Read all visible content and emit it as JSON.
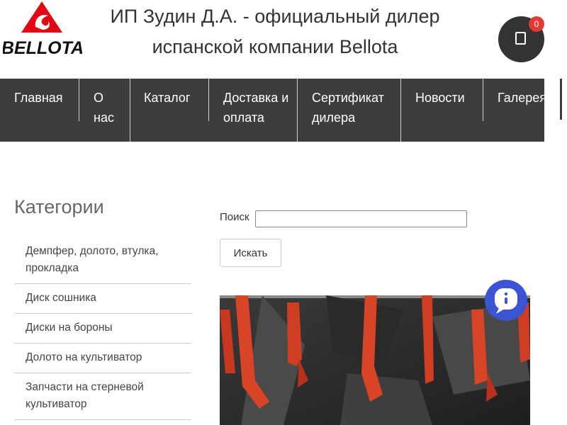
{
  "header": {
    "logo_text": "BELLOTA",
    "title": "ИП Зудин Д.А. - официальный дилер испанской компании Bellota",
    "cart_count": "0"
  },
  "nav": {
    "items": [
      {
        "label": "Главная"
      },
      {
        "label": "О нас"
      },
      {
        "label": "Каталог"
      },
      {
        "label": "Доставка и оплата"
      },
      {
        "label": "Сертификат дилера"
      },
      {
        "label": "Новости"
      },
      {
        "label": "Галерея"
      }
    ]
  },
  "sidebar": {
    "title": "Категории",
    "categories": [
      "Демпфер, долото, втулка, прокладка",
      "Диск сошника",
      "Диски на бороны",
      "Долото на культиватор",
      "Запчасти на стерневой культиватор"
    ]
  },
  "search": {
    "label": "Поиск",
    "value": "",
    "button_label": "Искать"
  },
  "icons": {
    "cart": "cart-icon",
    "chat": "chat-icon"
  },
  "colors": {
    "nav_bg": "#3d3d3d",
    "cart_bg": "#333333",
    "badge": "#e53935",
    "chat": "#3b54d4",
    "logo_red": "#e30613"
  }
}
